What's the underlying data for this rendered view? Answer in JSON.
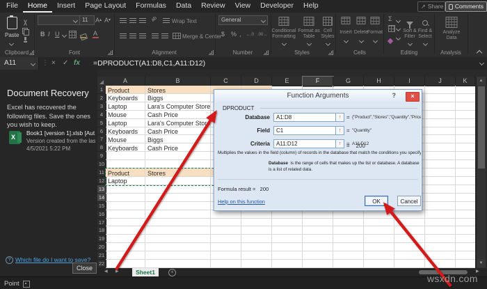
{
  "menu": {
    "tabs": [
      "File",
      "Home",
      "Insert",
      "Page Layout",
      "Formulas",
      "Data",
      "Review",
      "View",
      "Developer",
      "Help"
    ],
    "active": "Home",
    "share": "Share",
    "comments": "Comments"
  },
  "ribbon": {
    "groups": [
      "Clipboard",
      "Font",
      "Alignment",
      "Number",
      "Styles",
      "Cells",
      "Editing",
      "Analysis"
    ],
    "paste": "Paste",
    "font_size": "11",
    "glyphs": {
      "bold": "B",
      "italic": "I",
      "underline": "U",
      "currency": "$",
      "percent": "%",
      "comma": ",",
      "autosum": "Σ",
      "inc_dec": "←.0",
      "dec_dec": ".00→",
      "orientation": "ab"
    },
    "wrap_text": "Wrap Text",
    "merge_center": "Merge & Center",
    "number_format": "General",
    "conditional": [
      "Conditional",
      "Formatting"
    ],
    "format_table": [
      "Format as",
      "Table"
    ],
    "cell_styles": [
      "Cell",
      "Styles"
    ],
    "cells": [
      "Insert",
      "Delete",
      "Format"
    ],
    "sort_filter": [
      "Sort &",
      "Filter"
    ],
    "find_select": [
      "Find &",
      "Select"
    ],
    "analyze": [
      "Analyze",
      "Data"
    ]
  },
  "formula_bar": {
    "name_box": "A11",
    "x": "×",
    "check": "✓",
    "fx": "fx",
    "formula": "=DPRODUCT(A1:D8,C1,A11:D12)"
  },
  "recovery": {
    "title": "Document Recovery",
    "body": "Excel has recovered the following files.  Save the ones you wish to keep.",
    "file_icon_letter": "X",
    "file_name": "Book1 [version 1].xlsb  [Aut...",
    "file_desc": "Version created from the last...",
    "file_date": "4/5/2021 5:22 PM",
    "help_icon": "?",
    "help_link": "Which file do I want to save?",
    "close": "Close"
  },
  "sheet": {
    "columns": [
      "A",
      "B",
      "C",
      "D",
      "E",
      "F",
      "G",
      "H",
      "I",
      "J",
      "K"
    ],
    "highlighted_column": "F",
    "highlighted_rows": [
      13,
      14
    ],
    "rows": [
      {
        "n": 1,
        "a": "Product",
        "b": "Stores",
        "header": true
      },
      {
        "n": 2,
        "a": "Keyboards",
        "b": "Biggs"
      },
      {
        "n": 3,
        "a": "Laptop",
        "b": "Lara's Computer Store"
      },
      {
        "n": 4,
        "a": "Mouse",
        "b": "Cash Price"
      },
      {
        "n": 5,
        "a": "Laptop",
        "b": "Lara's Computer Store"
      },
      {
        "n": 6,
        "a": "Keyboards",
        "b": "Cash Price"
      },
      {
        "n": 7,
        "a": "Mouse",
        "b": "Biggs"
      },
      {
        "n": 8,
        "a": "Keyboards",
        "b": "Cash Price"
      },
      {
        "n": 9,
        "a": "",
        "b": ""
      },
      {
        "n": 10,
        "a": "",
        "b": ""
      },
      {
        "n": 11,
        "a": "Product",
        "b": "Stores",
        "header": true
      },
      {
        "n": 12,
        "a": "Laptop",
        "b": ""
      },
      {
        "n": 13,
        "a": "",
        "b": ""
      },
      {
        "n": 14,
        "a": "",
        "b": ""
      },
      {
        "n": 15,
        "a": "",
        "b": ""
      },
      {
        "n": 16,
        "a": "",
        "b": ""
      },
      {
        "n": 17,
        "a": "",
        "b": ""
      },
      {
        "n": 18,
        "a": "",
        "b": ""
      },
      {
        "n": 19,
        "a": "",
        "b": ""
      },
      {
        "n": 20,
        "a": "",
        "b": ""
      },
      {
        "n": 21,
        "a": "",
        "b": ""
      },
      {
        "n": 22,
        "a": "",
        "b": ""
      }
    ],
    "tab": "Sheet1"
  },
  "dialog": {
    "title": "Function Arguments",
    "help": "?",
    "close": "×",
    "function_name": "DPRODUCT",
    "eq": "=",
    "fields": [
      {
        "label": "Database",
        "value": "A1:D8",
        "result": "{\"Product\",\"Stores\",\"Quantity\",\"Price..."
      },
      {
        "label": "Field",
        "value": "C1",
        "result": "\"Quantity\""
      },
      {
        "label": "Criteria",
        "value": "A11:D12",
        "result": "A11:D12"
      }
    ],
    "result_equals": "=    200",
    "description": "Multiplies the values in the field (column) of records in the database that match the conditions you specify.",
    "db_term": "Database",
    "db_text": "is the range of cells that makes up the list or database. A database is a list of related data.",
    "formula_result": "Formula result =   200",
    "help_link": "Help on this function",
    "ok": "OK",
    "cancel": "Cancel"
  },
  "status": {
    "mode": "Point"
  },
  "watermark": "wsxdn.com",
  "colors": {
    "accent_green": "#217346",
    "header_fill": "#f9dfc2",
    "arrow_red": "#d31a1a",
    "dialog_blue": "#dde7f3"
  }
}
